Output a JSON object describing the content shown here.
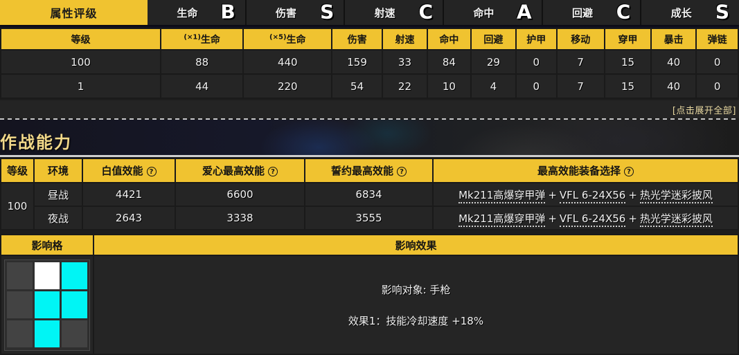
{
  "rating": {
    "title": "属性评级",
    "items": [
      {
        "name": "生命",
        "grade": "B"
      },
      {
        "name": "伤害",
        "grade": "S"
      },
      {
        "name": "射速",
        "grade": "C"
      },
      {
        "name": "命中",
        "grade": "A"
      },
      {
        "name": "回避",
        "grade": "C"
      },
      {
        "name": "成长",
        "grade": "S"
      }
    ]
  },
  "stats": {
    "headers": [
      "等级",
      "(×1)生命",
      "(×5)生命",
      "伤害",
      "射速",
      "命中",
      "回避",
      "护甲",
      "移动",
      "穿甲",
      "暴击",
      "弹链"
    ],
    "header_parts": [
      {
        "sup": "",
        "main": "等级"
      },
      {
        "sup": "(×1)",
        "main": "生命"
      },
      {
        "sup": "(×5)",
        "main": "生命"
      },
      {
        "sup": "",
        "main": "伤害"
      },
      {
        "sup": "",
        "main": "射速"
      },
      {
        "sup": "",
        "main": "命中"
      },
      {
        "sup": "",
        "main": "回避"
      },
      {
        "sup": "",
        "main": "护甲"
      },
      {
        "sup": "",
        "main": "移动"
      },
      {
        "sup": "",
        "main": "穿甲"
      },
      {
        "sup": "",
        "main": "暴击"
      },
      {
        "sup": "",
        "main": "弹链"
      }
    ],
    "rows": [
      [
        "100",
        "88",
        "440",
        "159",
        "33",
        "84",
        "29",
        "0",
        "7",
        "15",
        "40",
        "0"
      ],
      [
        "1",
        "44",
        "220",
        "54",
        "22",
        "10",
        "4",
        "0",
        "7",
        "15",
        "40",
        "0"
      ]
    ],
    "expand_label": "[点击展开全部]"
  },
  "combat": {
    "section_title": "作战能力",
    "headers": [
      {
        "label": "等级",
        "help": false
      },
      {
        "label": "环境",
        "help": false
      },
      {
        "label": "白值效能",
        "help": true
      },
      {
        "label": "爱心最高效能",
        "help": true
      },
      {
        "label": "誓约最高效能",
        "help": true
      },
      {
        "label": "最高效能装备选择",
        "help": true
      }
    ],
    "help_glyph": "?",
    "level": "100",
    "rows": [
      {
        "env": "昼战",
        "white": "4421",
        "love": "6600",
        "oath": "6834",
        "equipment": [
          "Mk211高爆穿甲弹",
          "VFL 6-24X56",
          "热光学迷彩披风"
        ]
      },
      {
        "env": "夜战",
        "white": "2643",
        "love": "3338",
        "oath": "3555",
        "equipment": [
          "Mk211高爆穿甲弹",
          "VFL 6-24X56",
          "热光学迷彩披风"
        ]
      }
    ],
    "equipment_joiner": "+"
  },
  "influence": {
    "grid_header": "影响格",
    "effect_header": "影响效果",
    "grid": [
      [
        "empty",
        "self",
        "active"
      ],
      [
        "empty",
        "active",
        "active"
      ],
      [
        "empty",
        "active",
        "empty"
      ]
    ],
    "target_line": "影响对象: 手枪",
    "effect_line": "效果1：技能冷却速度 +18%"
  },
  "colors": {
    "accent": "#f0c330",
    "panel": "#252525",
    "border": "#1a1a1a",
    "active_cell": "#00f5f5",
    "self_cell": "#ffffff",
    "empty_cell": "#434343",
    "section_title": "#f2d98a"
  }
}
